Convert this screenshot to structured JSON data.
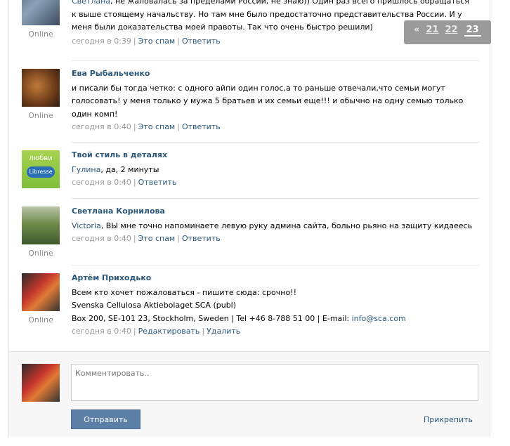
{
  "pager": {
    "prev": "«",
    "pages": [
      "21",
      "22",
      "23"
    ],
    "current": "23"
  },
  "posts": [
    {
      "online": "Online",
      "lines": [
        "<reply>Светлана</reply>, не жаловалась за пределами России, не знаю)) Один раз всего пришлось обращаться",
        "к выше стоящему начальству. Но там мне было предостаточно представительства России. И у",
        "меня были доказательства моей правоты. Так что очень быстро решили)"
      ],
      "time": "сегодня в 0:39",
      "actions": [
        "Это спам",
        "Ответить"
      ]
    },
    {
      "author": "Ева Рыбальченко",
      "online": "Online",
      "lines": [
        "и писали бы тогда четко: с одного айпи один голос,а то раньше отвечали,что семьи могут",
        "голосовать! у меня только у мужа 5 братьев и их семьи еще!!! и обычно на одну семью только",
        "один комп!"
      ],
      "time": "сегодня в 0:40",
      "actions": [
        "Это спам",
        "Ответить"
      ]
    },
    {
      "author": "Твой стиль в деталях",
      "avatar_text": [
        "любви",
        "Libresse"
      ],
      "reply_to": "Гулина",
      "text": ", да, 2 минуты",
      "time": "сегодня в 0:40",
      "actions": [
        "Ответить"
      ]
    },
    {
      "author": "Светлана Корнилова",
      "online": "Online",
      "reply_to": "Victoria",
      "text": ", ВЫ мне точно напоминаете левую руку админа сайта, больно рьяно на защиту кидаеесь",
      "time": "сегодня в 0:40",
      "actions": [
        "Это спам",
        "Ответить"
      ]
    },
    {
      "author": "Артём Приходько",
      "online": "Online",
      "lines": [
        "Всем кто хочет пожаловаться - пишите сюда: срочно!!",
        "Svenska Cellulosa Aktiebolaget SCA (publ)",
        "Box 200, SE-101 23, Stockholm, Sweden | Tel +46 8-788 51 00 | E-mail: "
      ],
      "email": "info@sca.com",
      "time": "сегодня в 0:40",
      "actions": [
        "Редактировать",
        "Удалить"
      ]
    }
  ],
  "composer": {
    "placeholder": "Комментировать..",
    "send_label": "Отправить",
    "attach_label": "Прикрепить"
  },
  "colors": {
    "link": "#2b587a",
    "button": "#5b7fa6",
    "meta": "#999999"
  }
}
